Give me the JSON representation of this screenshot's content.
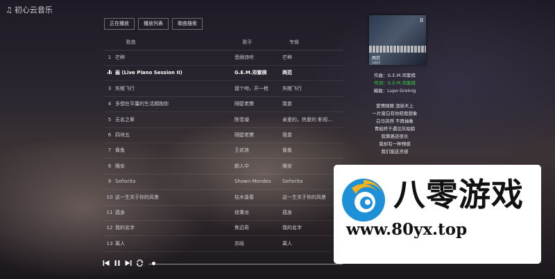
{
  "app": {
    "title": "初心云音乐"
  },
  "tabs": [
    "正在播放",
    "播放列表",
    "歌曲搜索"
  ],
  "list_header": {
    "title": "歌曲",
    "artist": "歌手",
    "album": "专辑"
  },
  "songs": [
    {
      "num": "1",
      "title": "芒种",
      "artist": "音阙诗听",
      "album": "芒种"
    },
    {
      "num": "",
      "title": "画 (Live Piano Session II)",
      "artist": "G.E.M.邓紫棋",
      "album": "两范",
      "playing": true
    },
    {
      "num": "3",
      "title": "失眠飞行",
      "artist": "接个吻，开一枪",
      "album": "失眠飞行"
    },
    {
      "num": "4",
      "title": "多想在平庸的生活拥抱你",
      "artist": "隔壁老樊",
      "album": "我曾"
    },
    {
      "num": "5",
      "title": "无名之辈",
      "artist": "陈雪凝",
      "album": "亲爱的，热爱的 影视..."
    },
    {
      "num": "6",
      "title": "四块五",
      "artist": "隔壁老樊",
      "album": "我曾"
    },
    {
      "num": "7",
      "title": "像鱼",
      "artist": "王贰浪",
      "album": "像鱼"
    },
    {
      "num": "8",
      "title": "晚安",
      "artist": "颜人中",
      "album": "晚安"
    },
    {
      "num": "9",
      "title": "Señorita",
      "artist": "Shawn Mendes",
      "album": "Señorita"
    },
    {
      "num": "10",
      "title": "这一生关于你的风景",
      "artist": "枯木逢春",
      "album": "这一生关于你的风景"
    },
    {
      "num": "11",
      "title": "孤身",
      "artist": "徐秉龙",
      "album": "孤身"
    },
    {
      "num": "12",
      "title": "我的名字",
      "artist": "焦迈奇",
      "album": "我的名字"
    },
    {
      "num": "13",
      "title": "离人",
      "artist": "苏晗",
      "album": "离人"
    }
  ],
  "cover": {
    "title": "两范",
    "artist": "邓紫棋",
    "mark": "II"
  },
  "lyrics": {
    "credits": [
      "作曲：G.E.M.邓紫棋",
      "作词：G.E.M.邓紫棋",
      "编曲：Lupo Groinig"
    ],
    "lines": [
      "爱情随随 渲染天上",
      "一片窗白有你陪我想象",
      "白马突然 不再抽象",
      "青蛙终于遇见灰姑娘",
      "就算路还很长",
      "我却有一种预感",
      "我们能这灵感"
    ]
  },
  "player": {
    "progress_fraction": 0.02
  },
  "ad": {
    "name": "八零游戏",
    "url": "www.80yx.top"
  },
  "colors": {
    "lyric_active": "#37d34a",
    "ad_background": "#ffffff"
  }
}
